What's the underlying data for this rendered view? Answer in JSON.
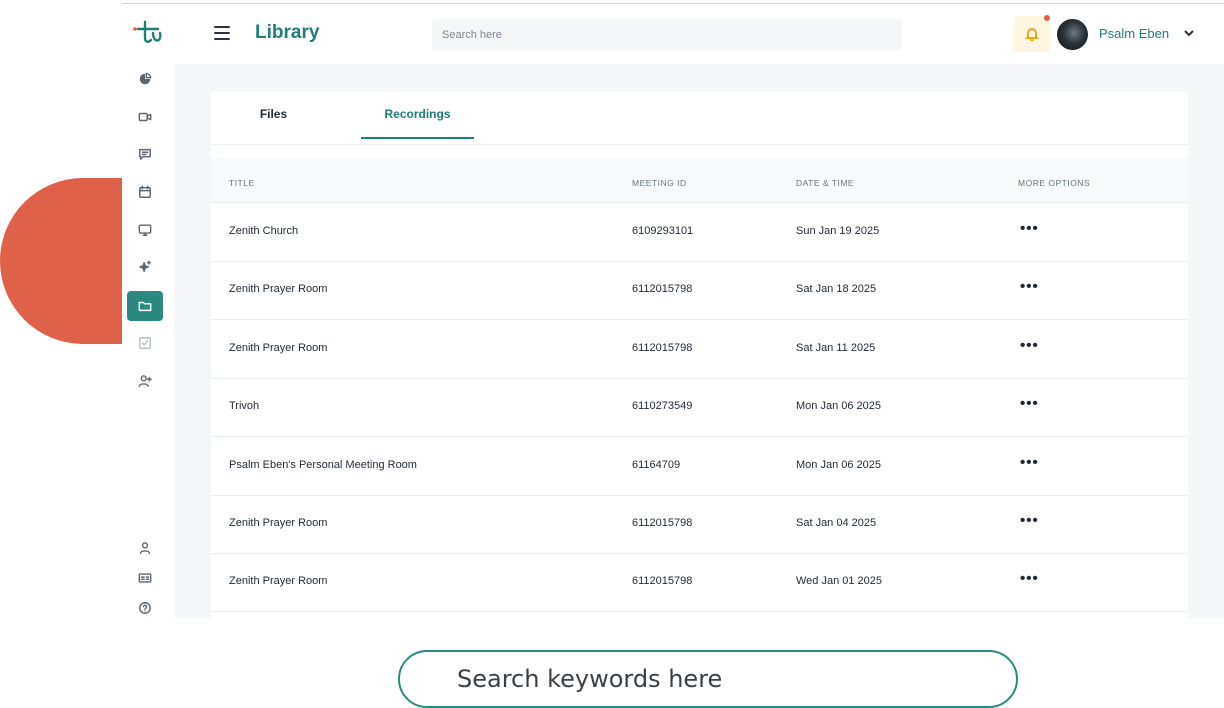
{
  "header": {
    "title": "Library",
    "search_placeholder": "Search here",
    "user_name": "Psalm Eben"
  },
  "sidebar": {
    "items": [
      {
        "name": "pie-chart-icon"
      },
      {
        "name": "video-camera-icon"
      },
      {
        "name": "chat-icon"
      },
      {
        "name": "calendar-icon"
      },
      {
        "name": "monitor-icon"
      },
      {
        "name": "sparkles-icon"
      },
      {
        "name": "folder-icon",
        "active": true
      },
      {
        "name": "checklist-icon"
      },
      {
        "name": "add-user-icon"
      },
      {
        "name": "user-icon"
      },
      {
        "name": "id-card-icon"
      },
      {
        "name": "help-icon"
      }
    ]
  },
  "tabs": {
    "files": "Files",
    "recordings": "Recordings",
    "active": "recordings"
  },
  "table": {
    "columns": {
      "title": "TITLE",
      "meeting_id": "MEETING ID",
      "date_time": "DATE & TIME",
      "more_options": "MORE OPTIONS"
    },
    "more_glyph": "•••",
    "rows": [
      {
        "title": "Zenith Church",
        "meeting_id": "6109293101",
        "date": "Sun Jan 19 2025"
      },
      {
        "title": "Zenith Prayer Room",
        "meeting_id": "6112015798",
        "date": "Sat Jan 18 2025"
      },
      {
        "title": "Zenith Prayer Room",
        "meeting_id": "6112015798",
        "date": "Sat Jan 11 2025"
      },
      {
        "title": "Trivoh",
        "meeting_id": "6110273549",
        "date": "Mon Jan 06 2025"
      },
      {
        "title": "Psalm Eben's Personal Meeting Room",
        "meeting_id": "61164709",
        "date": "Mon Jan 06 2025"
      },
      {
        "title": "Zenith Prayer Room",
        "meeting_id": "6112015798",
        "date": "Sat Jan 04 2025"
      },
      {
        "title": "Zenith Prayer Room",
        "meeting_id": "6112015798",
        "date": "Wed Jan 01 2025"
      }
    ]
  },
  "keyword_search": {
    "placeholder": "Search keywords here"
  },
  "colors": {
    "brand": "#1e7f76",
    "accent_active": "#2a8a80",
    "decor": "#e0614a",
    "bell": "#e8a400"
  }
}
